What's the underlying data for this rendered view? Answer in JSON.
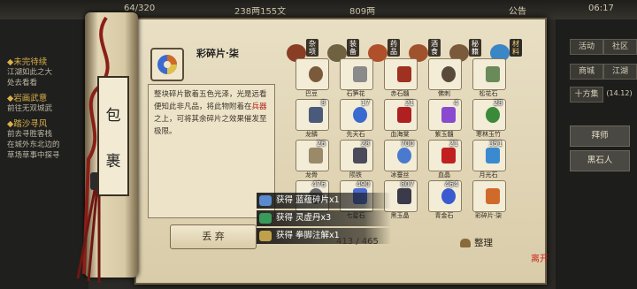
{
  "hud": {
    "time": "06:17",
    "notice": "公告",
    "resource1": "238两155文",
    "resource2": "809两",
    "hp": "64/320"
  },
  "quests": [
    {
      "title": "◆未完待续",
      "lines": [
        "江湖如此之大",
        "处去看看"
      ]
    },
    {
      "title": "◆岩画武意",
      "lines": [
        "前往无双城武"
      ]
    },
    {
      "title": "◆踏沙寻风",
      "lines": [
        "前去寻胜客栈",
        "在城外东北边的",
        "草场草事中探寻"
      ]
    }
  ],
  "right_panel": {
    "buttons": [
      "活动",
      "社区",
      "商城",
      "江湖",
      "十方集",
      "(14.12)"
    ],
    "big_buttons": [
      "拜师",
      "黑石人"
    ]
  },
  "scroll_label": [
    "包",
    "裹"
  ],
  "item": {
    "name": "彩碎片·柒",
    "desc_pre": "整块碎片散着五色光泽，光是远看便知此非凡品，将此物附着在",
    "desc_red": "兵器",
    "desc_post": "之上，可将其余碎片之效果催发至极限。"
  },
  "tabs": [
    {
      "label": "杂项",
      "color": "#8a3d25"
    },
    {
      "label": "装备",
      "color": "#6e6240"
    },
    {
      "label": "药品",
      "color": "#b0502a"
    },
    {
      "label": "酒食",
      "color": "#a0522d"
    },
    {
      "label": "秘籍",
      "color": "#7a5a3a"
    },
    {
      "label": "材料",
      "color": "#3b86c4"
    }
  ],
  "grid_items": [
    {
      "name": "巴豆",
      "count": "",
      "color": "#7a5a3a"
    },
    {
      "name": "石笋花",
      "count": "",
      "color": "#8a8a8a"
    },
    {
      "name": "赤石髓",
      "count": "",
      "color": "#a03020"
    },
    {
      "name": "佛刺",
      "count": "",
      "color": "#5a4a3a"
    },
    {
      "name": "松花石",
      "count": "",
      "color": "#6a8a5a"
    },
    {
      "name": "龙鳞",
      "count": "8",
      "color": "#4a5a7a"
    },
    {
      "name": "先天石",
      "count": "17",
      "color": "#3a6ad0"
    },
    {
      "name": "血海棠",
      "count": "21",
      "color": "#b02020"
    },
    {
      "name": "紫玉髓",
      "count": "4",
      "color": "#8a4ad0"
    },
    {
      "name": "寒林玉竹",
      "count": "28",
      "color": "#3a8a3a"
    },
    {
      "name": "龙骨",
      "count": "26",
      "color": "#9a8a6a"
    },
    {
      "name": "陨铁",
      "count": "28",
      "color": "#4a4a5a"
    },
    {
      "name": "冰蚕丝",
      "count": "700",
      "color": "#4a7ad0"
    },
    {
      "name": "血晶",
      "count": "21",
      "color": "#c02020"
    },
    {
      "name": "月光石",
      "count": "351",
      "color": "#3a8ad0"
    },
    {
      "name": "",
      "count": "476",
      "color": "#6a6a6a"
    },
    {
      "name": "七星石",
      "count": "490",
      "color": "#4a6ad0"
    },
    {
      "name": "黑玉晶",
      "count": "807",
      "color": "#3a3a4a"
    },
    {
      "name": "青金石",
      "count": "464",
      "color": "#3a5ad0"
    },
    {
      "name": "彩碎片·柒",
      "count": "",
      "color": "#d06a2a"
    }
  ],
  "notifications": [
    {
      "text": "获得 蓝蕴碎片x1",
      "color": "#5a8ad0"
    },
    {
      "text": "获得 灵虚丹x3",
      "color": "#3a9a5a"
    },
    {
      "text": "获得 拳脚注解x1",
      "color": "#c0a04a"
    }
  ],
  "discard_label": "丢 弃",
  "capacity": "413 / 465",
  "tidy_label": "整理",
  "stamp": "离开"
}
